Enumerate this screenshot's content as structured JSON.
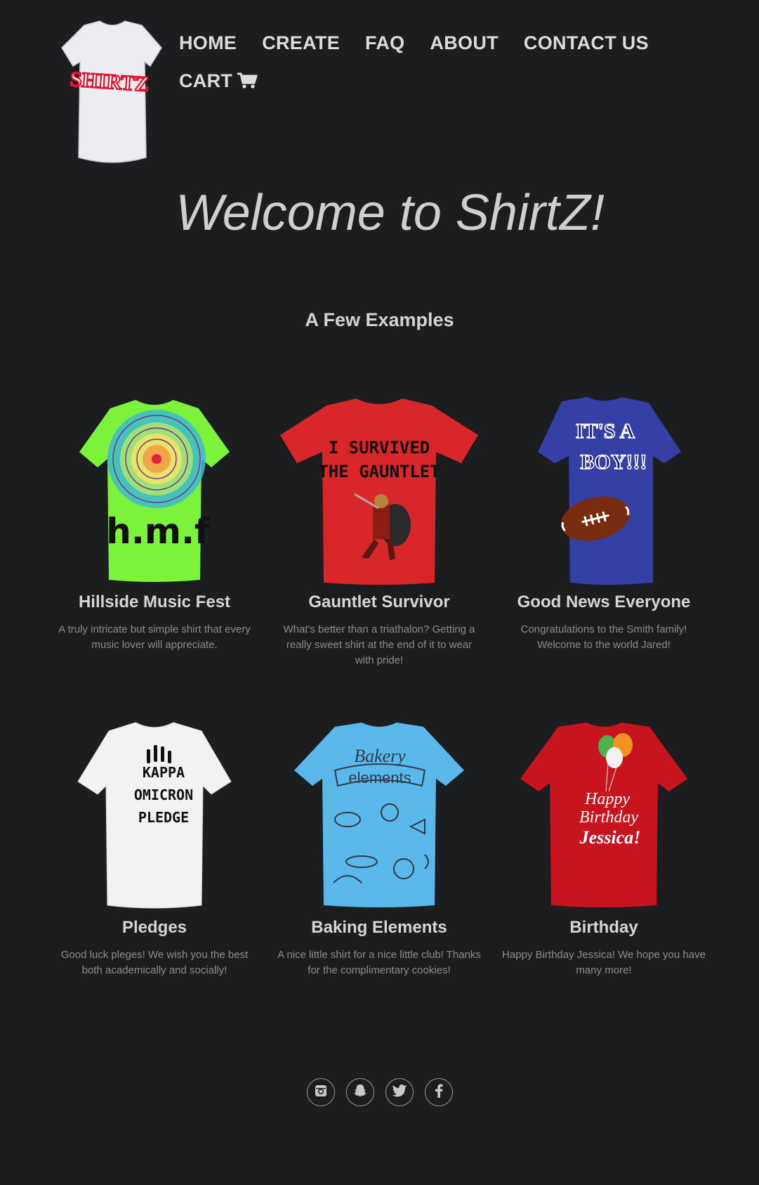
{
  "brand": {
    "logo_text": "SHIRTZ"
  },
  "nav": {
    "items": [
      {
        "label": "HOME"
      },
      {
        "label": "CREATE"
      },
      {
        "label": "FAQ"
      },
      {
        "label": "ABOUT"
      },
      {
        "label": "CONTACT US"
      }
    ],
    "cart_label": "CART"
  },
  "hero": {
    "title": "Welcome to ShirtZ!"
  },
  "examples": {
    "title": "A Few Examples",
    "items": [
      {
        "title": "Hillside Music Fest",
        "description": "A truly intricate but simple shirt that every music lover will appreciate.",
        "shirt_color": "#7cf23a",
        "print_text": "h.m.f"
      },
      {
        "title": "Gauntlet Survivor",
        "description": "What's better than a triathalon? Getting a really sweet shirt at the end of it to wear with pride!",
        "shirt_color": "#d9262b",
        "print_text": "I SURVIVED THE GAUNTLET"
      },
      {
        "title": "Good News Everyone",
        "description": "Congratulations to the Smith family! Welcome to the world Jared!",
        "shirt_color": "#3540a6",
        "print_text": "IT'S A BOY!!!"
      },
      {
        "title": "Pledges",
        "description": "Good luck pleges! We wish you the best both academically and socially!",
        "shirt_color": "#f2f2f2",
        "print_text": "KAPPA OMICRON PLEDGE"
      },
      {
        "title": "Baking Elements",
        "description": "A nice little shirt for a nice little club! Thanks for the complimentary cookies!",
        "shirt_color": "#5bb8ea",
        "print_text": "Bakery elements"
      },
      {
        "title": "Birthday",
        "description": "Happy Birthday Jessica! We hope you have many more!",
        "shirt_color": "#c8141e",
        "print_text": "Happy Birthday Jessica!"
      }
    ]
  },
  "social": [
    {
      "icon": "instagram-icon"
    },
    {
      "icon": "snapchat-icon"
    },
    {
      "icon": "twitter-icon"
    },
    {
      "icon": "facebook-icon"
    }
  ]
}
